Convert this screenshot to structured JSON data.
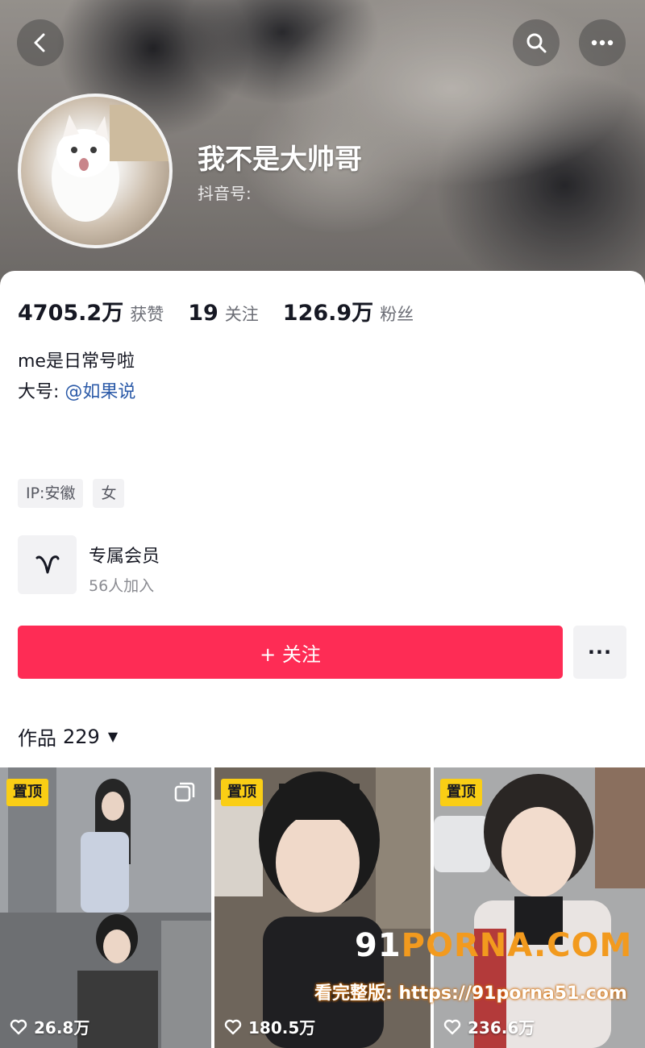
{
  "header": {
    "nickname": "我不是大帅哥",
    "douyin_id_label": "抖音号:"
  },
  "stats": [
    {
      "value": "4705.2万",
      "label": "获赞"
    },
    {
      "value": "19",
      "label": "关注"
    },
    {
      "value": "126.9万",
      "label": "粉丝"
    }
  ],
  "bio": {
    "line1": "me是日常号啦",
    "line2_prefix": "大号:",
    "line2_mention": "@如果说"
  },
  "tags": [
    "IP:安徽",
    "女"
  ],
  "membership": {
    "title": "专属会员",
    "subtitle": "56人加入"
  },
  "actions": {
    "follow_label": "+ 关注",
    "more_label": "···"
  },
  "works": {
    "label": "作品",
    "count": "229",
    "items": [
      {
        "pin": "置顶",
        "likes": "26.8万"
      },
      {
        "pin": "置顶",
        "likes": "180.5万"
      },
      {
        "pin": "置顶",
        "likes": "236.6万"
      }
    ]
  },
  "watermark": {
    "logo_prefix": "91",
    "logo_main": "PORNA.COM",
    "text": "看完整版: https://91porna51.com"
  },
  "colors": {
    "accent": "#fe2c55",
    "pin": "#face15",
    "mention": "#2b5aa8"
  }
}
